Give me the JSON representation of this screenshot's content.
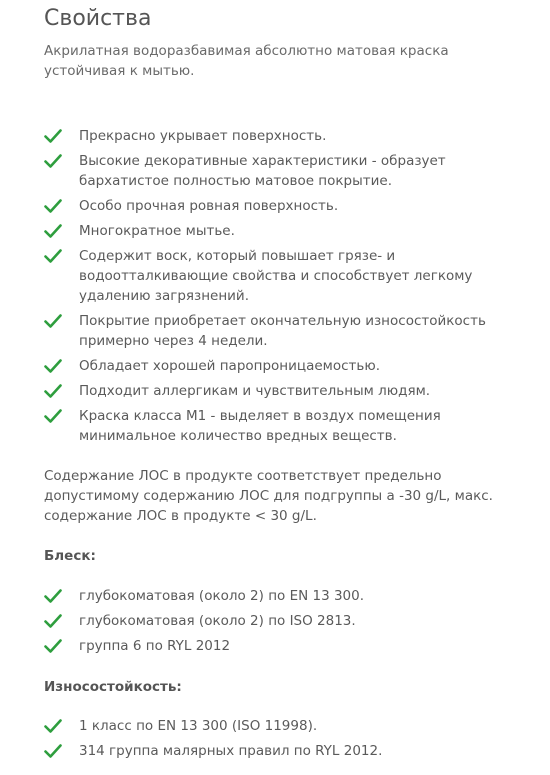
{
  "title": "Свойства",
  "intro": "Акрилатная водоразбавимая абсолютно матовая краска устойчивая к мытью.",
  "check_color": "#2e9e3e",
  "features": [
    "Прекрасно укрывает поверхность.",
    "Высокие декоративные характеристики - образует бархатистое полностью матовое покрытие.",
    "Особо прочная ровная поверхность.",
    "Многократное мытье.",
    "Содержит воск, который повышает грязе- и водоотталкивающие свойства и способствует легкому удалению загрязнений.",
    "Покрытие приобретает окончательную износостойкость примерно через 4 недели.",
    "Обладает хорошей паропроницаемостью.",
    "Подходит аллергикам и чувствительным людям.",
    "Краска класса М1 - выделяет в воздух помещения минимальное количество вредных веществ."
  ],
  "voc_text": "Содержание ЛОС в продукте соответствует предельно допустимому содержанию ЛОС для подгруппы а -30 g/L, макс. содержание ЛОС в продукте < 30 g/L.",
  "gloss": {
    "heading": "Блеск:",
    "items": [
      "глубокоматовая  (около 2) по EN 13 300.",
      "глубокоматовая (около 2) по ISO 2813.",
      "группа 6 по RYL 2012"
    ]
  },
  "wear": {
    "heading": "Износостойкость:",
    "items": [
      "1 класс по EN 13 300 (ISO 11998).",
      "314 группа малярных правил по RYL 2012."
    ]
  }
}
